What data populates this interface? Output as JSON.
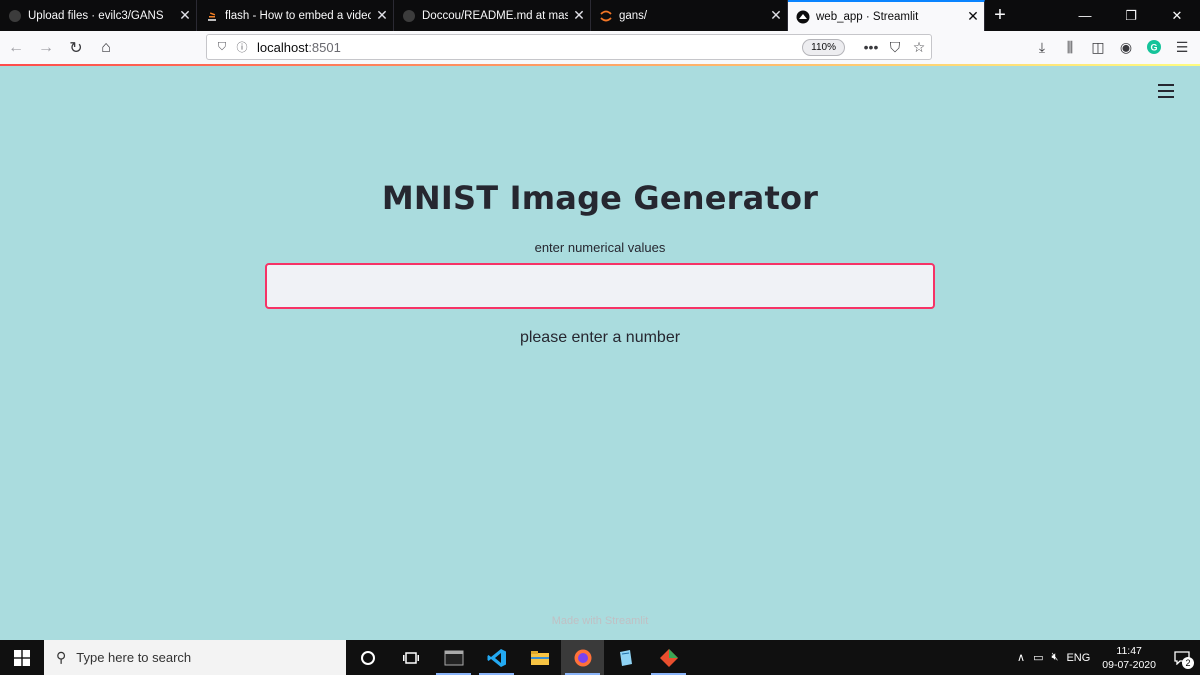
{
  "browser": {
    "tabs": [
      {
        "title": "Upload files · evilc3/GANS",
        "icon": "github-icon",
        "active": false
      },
      {
        "title": "flash - How to embed a video i",
        "icon": "stackoverflow-icon",
        "active": false
      },
      {
        "title": "Doccou/README.md at maste",
        "icon": "github-icon",
        "active": false
      },
      {
        "title": "gans/",
        "icon": "jupyter-icon",
        "active": false
      },
      {
        "title": "web_app · Streamlit",
        "icon": "streamlit-icon",
        "active": true
      }
    ],
    "url_host": "localhost",
    "url_port": ":8501",
    "zoom": "110%"
  },
  "app": {
    "title": "MNIST Image Generator",
    "input_label": "enter numerical values",
    "input_value": "",
    "message": "please enter a number",
    "footer": "Made with Streamlit",
    "colors": {
      "background": "#aadcde",
      "input_border": "#f63366",
      "text": "#262730"
    }
  },
  "taskbar": {
    "search_placeholder": "Type here to search",
    "language": "ENG",
    "time": "11:47",
    "date": "09-07-2020",
    "notification_count": "2"
  }
}
